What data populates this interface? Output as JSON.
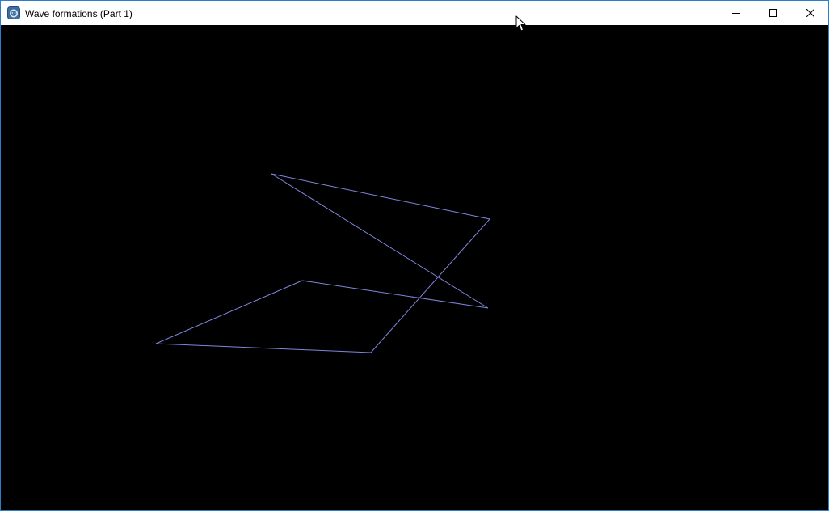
{
  "window": {
    "title": "Wave formations (Part 1)",
    "app_icon": "gear-app-icon",
    "border_color": "#2b7fc8"
  },
  "controls": {
    "minimize_icon": "minimize-icon",
    "maximize_icon": "maximize-icon",
    "close_icon": "close-icon"
  },
  "scene": {
    "background_color": "#000000",
    "line_color": "#7f86dd"
  },
  "cursor": {
    "icon": "arrow-cursor-icon"
  }
}
